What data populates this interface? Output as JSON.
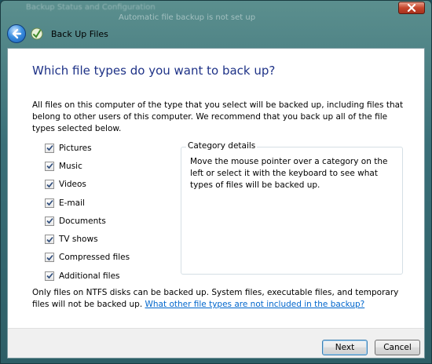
{
  "background_window": {
    "title_blurred": "Backup Status and Configuration",
    "status_blurred": "Automatic file backup is not set up"
  },
  "window": {
    "title": "Back Up Files",
    "icons": {
      "back": "back-arrow-icon",
      "app": "backup-icon",
      "close": "close-icon"
    }
  },
  "main": {
    "heading": "Which file types do you want to back up?",
    "intro": "All files on this computer of the type that you select will be backed up, including files that belong to other users of this computer. We recommend that you back up all of the file types selected below.",
    "file_types": [
      {
        "label": "Pictures",
        "checked": true
      },
      {
        "label": "Music",
        "checked": true
      },
      {
        "label": "Videos",
        "checked": true
      },
      {
        "label": "E-mail",
        "checked": true
      },
      {
        "label": "Documents",
        "checked": true
      },
      {
        "label": "TV shows",
        "checked": true
      },
      {
        "label": "Compressed files",
        "checked": true
      },
      {
        "label": "Additional files",
        "checked": true
      }
    ],
    "category_details": {
      "title": "Category details",
      "text": "Move the mouse pointer over a category on the left or select it with the keyboard to see what types of files will be backed up."
    },
    "note_text": "Only files on NTFS disks can be backed up. System files, executable files, and temporary files will not be backed up.",
    "note_link": "What other file types are not included in the backup?"
  },
  "buttons": {
    "next": "Next",
    "cancel": "Cancel"
  },
  "colors": {
    "heading": "#1e3287",
    "link": "#0066cc",
    "close_button": "#c6462c"
  }
}
